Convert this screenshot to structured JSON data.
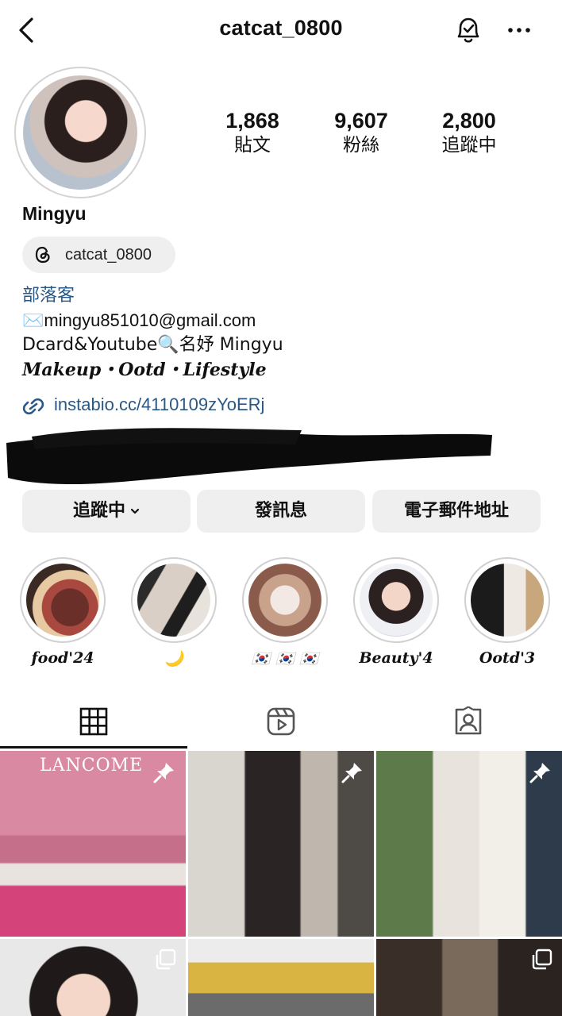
{
  "header": {
    "title": "catcat_0800",
    "back_icon": "back-arrow-icon",
    "bell_icon": "bell-check-icon",
    "more_icon": "more-horizontal-icon"
  },
  "profile": {
    "display_name": "Mingyu",
    "threads_handle": "catcat_0800",
    "stats": [
      {
        "value": "1,868",
        "label": "貼文"
      },
      {
        "value": "9,607",
        "label": "粉絲"
      },
      {
        "value": "2,800",
        "label": "追蹤中"
      }
    ],
    "bio": {
      "category": "部落客",
      "line1": "✉️mingyu851010@gmail.com",
      "line2": "Dcard&Youtube🔍名妤 Mingyu",
      "line3": "𝑴𝒂𝒌𝒆𝒖𝒑・𝑶𝒐𝒕𝒅・𝑳𝒊𝒇𝒆𝒔𝒕𝒚𝒍𝒆",
      "link": "instabio.cc/4110109zYoERj"
    }
  },
  "actions": {
    "following": "追蹤中",
    "message": "發訊息",
    "email": "電子郵件地址"
  },
  "highlights": [
    {
      "label": "food'24"
    },
    {
      "label": "🌙"
    },
    {
      "label": "🇰🇷 🇰🇷 🇰🇷"
    },
    {
      "label": "Beauty'4"
    },
    {
      "label": "Ootd'3"
    }
  ],
  "tabs": [
    "grid-icon",
    "reels-icon",
    "tagged-icon"
  ],
  "posts": [
    {
      "caption": "LANCOME",
      "pinned": true
    },
    {
      "pinned": true
    },
    {
      "pinned": true
    },
    {
      "multi": true
    },
    {
      "multi": false
    },
    {
      "multi": true
    }
  ],
  "colors": {
    "link": "#2a5885",
    "button_bg": "#efefef",
    "ring": "#d0d0d0"
  }
}
